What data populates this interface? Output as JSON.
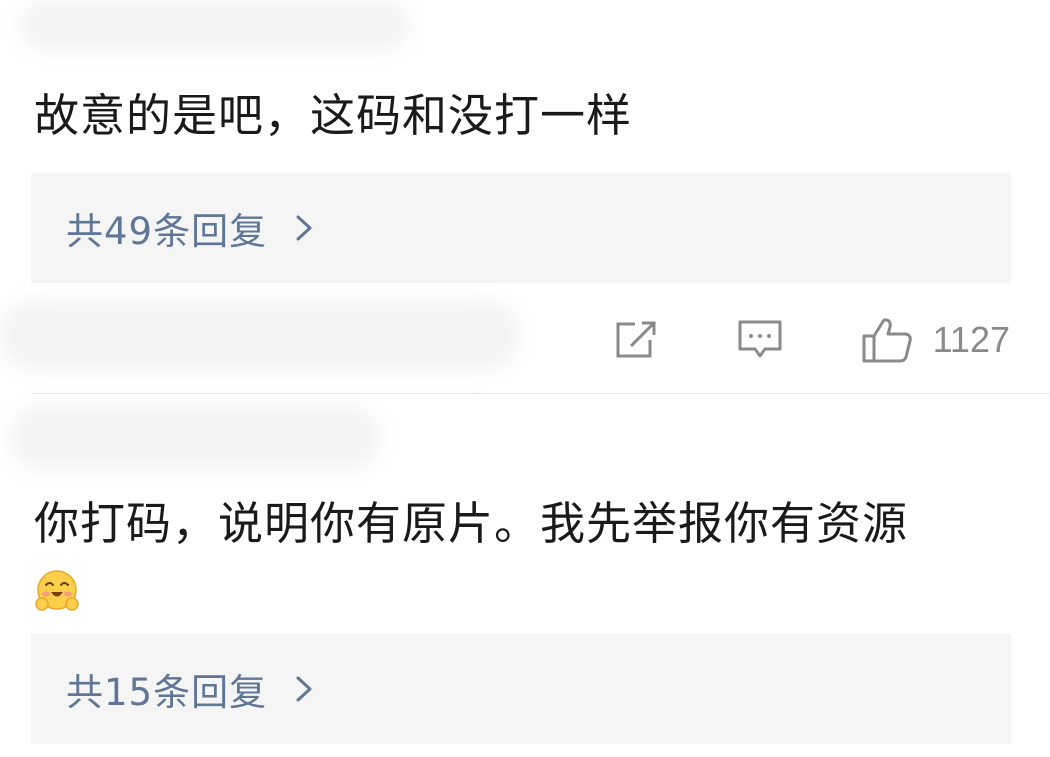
{
  "comments": [
    {
      "text": "故意的是吧，这码和没打一样",
      "reply_summary": "共49条回复"
    },
    {
      "text": "你打码，说明你有原片。我先举报你有资源",
      "emoji_icon": "laughing-hug-emoji",
      "reply_summary": "共15条回复"
    }
  ],
  "actions": {
    "like_count": "1127",
    "icons": [
      "share-icon",
      "comment-icon",
      "thumbs-up-icon"
    ]
  },
  "colors": {
    "reply_link": "#5f7696",
    "reply_bg": "#f5f5f5",
    "text": "#1a1a1a",
    "muted": "#8a8a8a"
  }
}
